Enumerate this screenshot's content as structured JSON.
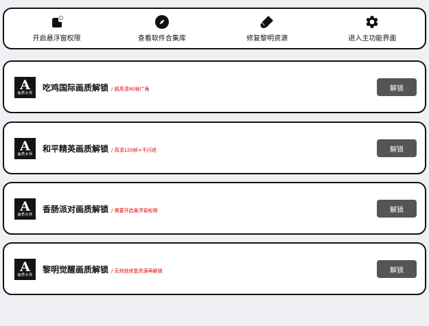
{
  "toolbar": {
    "items": [
      {
        "label": "开启悬浮窗权限",
        "icon": "floating-window-icon"
      },
      {
        "label": "查看软件合集库",
        "icon": "compass-icon"
      },
      {
        "label": "修复黎明资源",
        "icon": "eraser-icon"
      },
      {
        "label": "进入主功能界面",
        "icon": "gear-icon"
      }
    ]
  },
  "items": [
    {
      "title": "吃鸡国际画质解锁",
      "note": "/ 超高清90帧广角",
      "button": "解锁",
      "logo_big": "A",
      "logo_small": "画质大师"
    },
    {
      "title": "和平精英画质解锁",
      "note": "/ 高清120帧+不闪退",
      "button": "解锁",
      "logo_big": "A",
      "logo_small": "画质大师"
    },
    {
      "title": "香肠派对画质解锁",
      "note": "/ 需要开启悬浮窗权限",
      "button": "解锁",
      "logo_big": "A",
      "logo_small": "画质大师"
    },
    {
      "title": "黎明觉醒画质解锁",
      "note": "/ 无效就修复资源再解锁",
      "button": "解锁",
      "logo_big": "A",
      "logo_small": "画质大师"
    }
  ],
  "colors": {
    "background": "#efeff4",
    "card": "#ffffff",
    "border": "#111111",
    "button": "#555555",
    "note": "#e00000"
  }
}
